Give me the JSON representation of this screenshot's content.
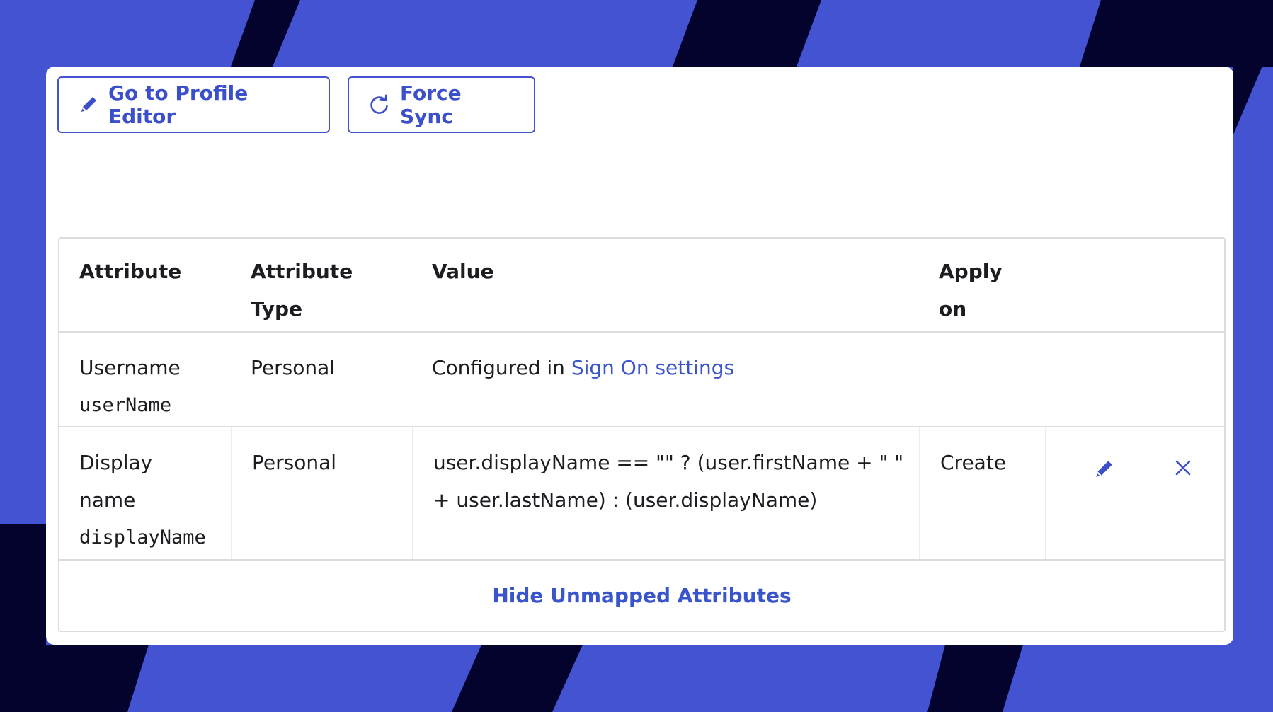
{
  "toolbar": {
    "profile_editor_label": "Go to Profile Editor",
    "force_sync_label": "Force Sync"
  },
  "table": {
    "headers": {
      "attribute": "Attribute",
      "attribute_type_1": "Attribute",
      "attribute_type_2": "Type",
      "value": "Value",
      "apply_on_1": "Apply",
      "apply_on_2": "on"
    },
    "rows": [
      {
        "label_1": "Username",
        "variable": "userName",
        "type": "Personal",
        "value_prefix": "Configured in ",
        "value_link": "Sign On settings"
      },
      {
        "label_1": "Display",
        "label_2": "name",
        "variable": "displayName",
        "type": "Personal",
        "value": "user.displayName == \"\" ? (user.firstName + \" \" + user.lastName) : (user.displayName)",
        "apply_on": "Create",
        "edit_icon": "pencil-icon",
        "delete_icon": "close-icon"
      }
    ],
    "footer_link": "Hide Unmapped Attributes"
  },
  "colors": {
    "accent": "#4353d2",
    "background_dark": "#03032e",
    "link": "#3a55cc"
  }
}
